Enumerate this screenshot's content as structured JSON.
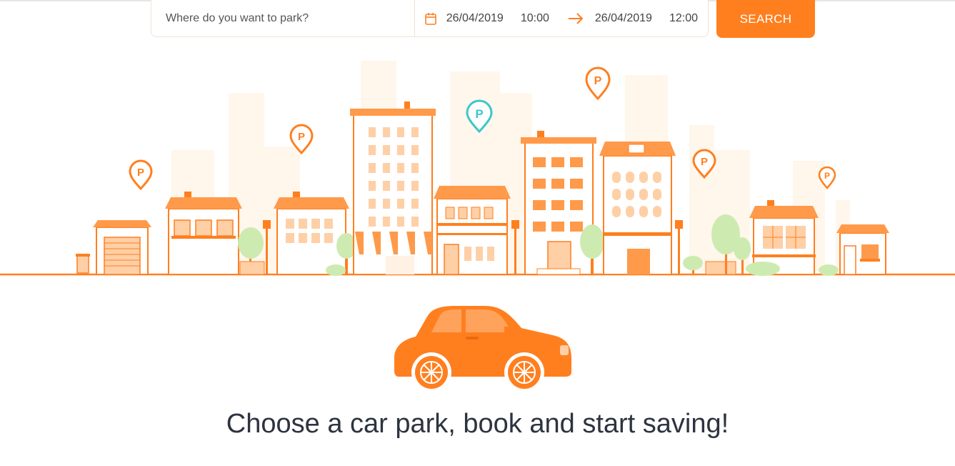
{
  "search": {
    "placeholder": "Where do you want to park?",
    "start_date": "26/04/2019",
    "start_time": "10:00",
    "end_date": "26/04/2019",
    "end_time": "12:00",
    "button_label": "SEARCH",
    "calendar_icon": "calendar-icon",
    "arrow_icon": "arrow-right-icon"
  },
  "hero": {
    "illustration": "city-skyline-with-parking-pins",
    "car_illustration": "orange-car"
  },
  "headline": "Choose a car park, book and start saving!",
  "colors": {
    "accent": "#ff7f1f",
    "light_orange": "#ffcfa6",
    "pin_highlight": "#3cc8c8",
    "headline_text": "#2c3440"
  }
}
